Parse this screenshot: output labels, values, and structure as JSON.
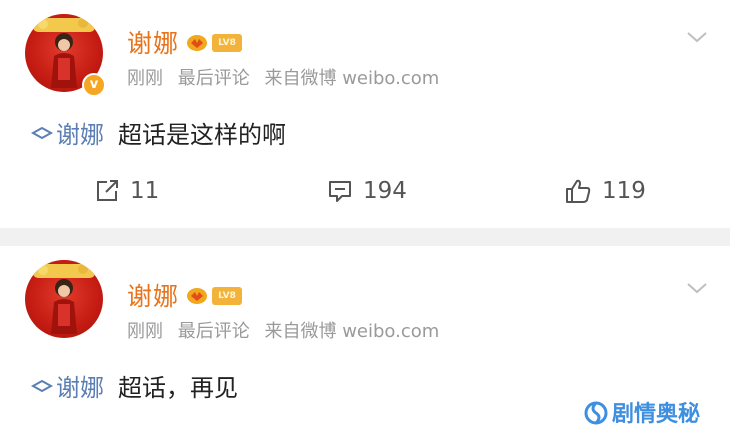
{
  "posts": [
    {
      "username": "谢娜",
      "level_badge": "LV8",
      "verify_mark": "v",
      "meta": {
        "time": "刚刚",
        "status": "最后评论",
        "source": "来自微博 weibo.com"
      },
      "topic": "谢娜",
      "text": "超话是这样的啊",
      "actions": {
        "reposts": "11",
        "comments": "194",
        "likes": "119"
      }
    },
    {
      "username": "谢娜",
      "level_badge": "LV8",
      "meta": {
        "time": "刚刚",
        "status": "最后评论",
        "source": "来自微博 weibo.com"
      },
      "topic": "谢娜",
      "text": "超话，再见"
    }
  ],
  "watermark": {
    "text": "剧情奥秘"
  },
  "colors": {
    "username": "#e8731a",
    "topic_link": "#5b7fb4",
    "meta": "#9a9a9a",
    "separator": "#f1f1f1",
    "watermark": "#3f8fe0"
  },
  "icons": [
    "avatar-photo",
    "verified-badge-icon",
    "vip-badge-icon",
    "level-badge",
    "chevron-down-icon",
    "super-topic-icon",
    "repost-icon",
    "comment-icon",
    "like-icon",
    "watermark-logo-icon"
  ]
}
